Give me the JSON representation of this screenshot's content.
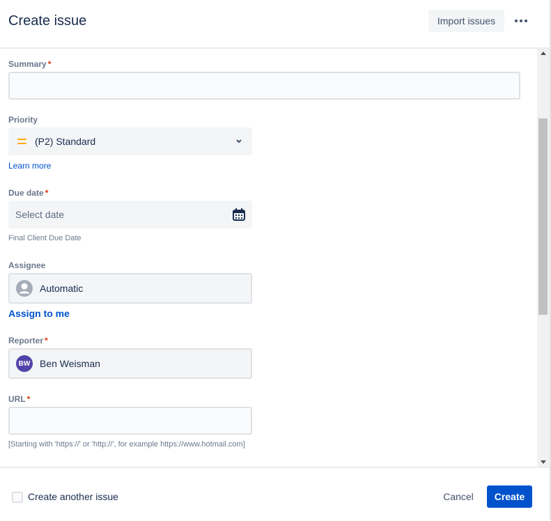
{
  "header": {
    "title": "Create issue",
    "import_label": "Import issues"
  },
  "form": {
    "summary": {
      "label": "Summary",
      "value": ""
    },
    "priority": {
      "label": "Priority",
      "value": "(P2) Standard",
      "icon": "priority-medium-icon",
      "icon_color": "#ffab00",
      "learn_more": "Learn more"
    },
    "due_date": {
      "label": "Due date",
      "placeholder": "Select date",
      "help": "Final Client Due Date"
    },
    "assignee": {
      "label": "Assignee",
      "value": "Automatic",
      "assign_to_me": "Assign to me"
    },
    "reporter": {
      "label": "Reporter",
      "value": "Ben Weisman",
      "initials": "BW",
      "avatar_color": "#5243aa"
    },
    "url": {
      "label": "URL",
      "value": "",
      "help": "[Starting with 'https://' or 'http://', for example https://www.hotmail.com]"
    }
  },
  "required_marker": "*",
  "footer": {
    "create_another_label": "Create another issue",
    "cancel_label": "Cancel",
    "create_label": "Create"
  },
  "colors": {
    "primary": "#0052cc",
    "required": "#de350b"
  }
}
